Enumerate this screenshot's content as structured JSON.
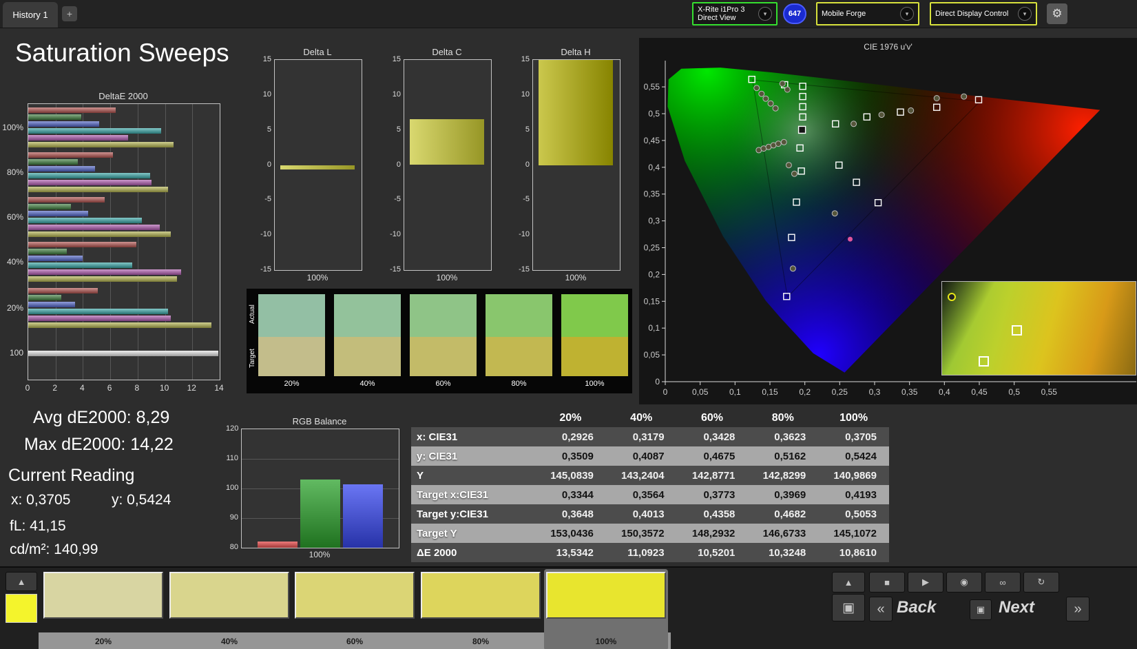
{
  "colors": {
    "meter_green": "#35e02f",
    "control_yellow": "#d8e23c",
    "badge_blue": "#1a2bd0"
  },
  "icons": {
    "chevron_down": "▾",
    "gear": "⚙",
    "add": "+",
    "chevron_up": "▲",
    "stop": "■",
    "play": "▶",
    "record": "◉",
    "continuous": "∞",
    "refresh": "↻",
    "back_chevrons": "«",
    "forward_chevrons": "»",
    "frame": "▣"
  },
  "window": {
    "tabs": [
      {
        "label": "History 1"
      }
    ],
    "meter": {
      "line1": "X-Rite i1Pro 3",
      "line2": "Direct View"
    },
    "meter_badge": "647",
    "source_label": "Mobile Forge",
    "display_control_label": "Direct Display Control"
  },
  "page": {
    "title": "Saturation Sweeps"
  },
  "readouts": {
    "avg": "Avg dE2000: 8,29",
    "max": "Max dE2000: 14,22",
    "current_heading": "Current Reading",
    "x": "x: 0,3705",
    "y": "y: 0,5424",
    "fl": "fL: 41,15",
    "cdm2": "cd/m²: 140,99"
  },
  "table": {
    "columns": [
      "20%",
      "40%",
      "60%",
      "80%",
      "100%"
    ],
    "rows": [
      {
        "label": "x: CIE31",
        "values": [
          "0,2926",
          "0,3179",
          "0,3428",
          "0,3623",
          "0,3705"
        ]
      },
      {
        "label": "y: CIE31",
        "values": [
          "0,3509",
          "0,4087",
          "0,4675",
          "0,5162",
          "0,5424"
        ]
      },
      {
        "label": "Y",
        "values": [
          "145,0839",
          "143,2404",
          "142,8771",
          "142,8299",
          "140,9869"
        ]
      },
      {
        "label": "Target x:CIE31",
        "values": [
          "0,3344",
          "0,3564",
          "0,3773",
          "0,3969",
          "0,4193"
        ]
      },
      {
        "label": "Target y:CIE31",
        "values": [
          "0,3648",
          "0,4013",
          "0,4358",
          "0,4682",
          "0,5053"
        ]
      },
      {
        "label": "Target Y",
        "values": [
          "153,0436",
          "150,3572",
          "148,2932",
          "146,6733",
          "145,1072"
        ]
      },
      {
        "label": "ΔE 2000",
        "values": [
          "13,5342",
          "11,0923",
          "10,5201",
          "10,3248",
          "10,8610"
        ]
      }
    ]
  },
  "swatch_strip": {
    "row_labels": [
      "Actual",
      "Target"
    ],
    "columns": [
      {
        "label": "20%",
        "actual": "#93bfa4",
        "target": "#c3bd8b"
      },
      {
        "label": "40%",
        "actual": "#93c29b",
        "target": "#c3bd7b"
      },
      {
        "label": "60%",
        "actual": "#8fc487",
        "target": "#c3bb68"
      },
      {
        "label": "80%",
        "actual": "#89c66d",
        "target": "#c2b851"
      },
      {
        "label": "100%",
        "actual": "#80c94b",
        "target": "#bfb231"
      }
    ]
  },
  "bottom": {
    "levels": [
      {
        "label": "20%",
        "color": "#d8d5a2",
        "selected": false
      },
      {
        "label": "40%",
        "color": "#d9d58d",
        "selected": false
      },
      {
        "label": "60%",
        "color": "#dbd575",
        "selected": false
      },
      {
        "label": "80%",
        "color": "#ddd55c",
        "selected": false
      },
      {
        "label": "100%",
        "color": "#e8e52e",
        "selected": true
      }
    ],
    "current_color": "#f4f42c",
    "back_label": "Back",
    "next_label": "Next"
  },
  "chart_data": [
    {
      "id": "deltae2000",
      "type": "bar",
      "orientation": "horizontal",
      "title": "DeltaE 2000",
      "xlim": [
        0,
        14
      ],
      "x_ticks": [
        0,
        2,
        4,
        6,
        8,
        10,
        12,
        14
      ],
      "groups": [
        {
          "label": "100%",
          "values": [
            6.4,
            3.9,
            5.2,
            9.7,
            7.3,
            10.6
          ]
        },
        {
          "label": "80%",
          "values": [
            6.2,
            3.6,
            4.9,
            8.9,
            9.0,
            10.2
          ]
        },
        {
          "label": "60%",
          "values": [
            5.6,
            3.1,
            4.4,
            8.3,
            9.6,
            10.4
          ]
        },
        {
          "label": "40%",
          "values": [
            7.9,
            2.8,
            4.0,
            7.6,
            11.2,
            10.9
          ]
        },
        {
          "label": "20%",
          "values": [
            5.1,
            2.4,
            3.4,
            10.2,
            10.4,
            13.4
          ]
        },
        {
          "label": "100",
          "values": [
            13.9
          ]
        }
      ],
      "bar_colors": [
        "#b2524e",
        "#3f7f3f",
        "#5064c8",
        "#38a8a8",
        "#b05ab0",
        "#b4b44e"
      ],
      "white_color": "#e6e6e6"
    },
    {
      "id": "deltaL",
      "type": "bar",
      "title": "Delta L",
      "ylim": [
        -15,
        15
      ],
      "y_ticks": [
        15,
        10,
        5,
        0,
        -5,
        -10,
        -15
      ],
      "x_label": "100%",
      "value": -0.6,
      "color": "#c9c832"
    },
    {
      "id": "deltaC",
      "type": "bar",
      "title": "Delta C",
      "ylim": [
        -15,
        15
      ],
      "y_ticks": [
        15,
        10,
        5,
        0,
        -5,
        -10,
        -15
      ],
      "x_label": "100%",
      "value": 6.5,
      "color": "#c9c832"
    },
    {
      "id": "deltaH",
      "type": "bar",
      "title": "Delta H",
      "ylim": [
        -15,
        15
      ],
      "y_ticks": [
        15,
        10,
        5,
        0,
        -5,
        -10,
        -15
      ],
      "x_label": "100%",
      "value": 15,
      "color": "#b4b000"
    },
    {
      "id": "rgb_balance",
      "type": "bar",
      "title": "RGB Balance",
      "ylim": [
        80,
        120
      ],
      "y_ticks": [
        120,
        110,
        100,
        90,
        80
      ],
      "x_label": "100%",
      "series": [
        {
          "name": "Red",
          "value": 82.2,
          "color": "#e85050"
        },
        {
          "name": "Green",
          "value": 103.0,
          "color": "#2da32d"
        },
        {
          "name": "Blue",
          "value": 101.3,
          "color": "#3848f0"
        }
      ]
    },
    {
      "id": "cie1976",
      "type": "scatter",
      "title": "CIE 1976 u'v'",
      "xlim": [
        0,
        0.676
      ],
      "ylim": [
        0,
        0.599
      ],
      "x_ticks": [
        "0",
        "0,05",
        "0,1",
        "0,15",
        "0,2",
        "0,25",
        "0,3",
        "0,35",
        "0,4",
        "0,45",
        "0,5",
        "0,55"
      ],
      "y_ticks": [
        "0",
        "0,05",
        "0,1",
        "0,15",
        "0,2",
        "0,25",
        "0,3",
        "0,35",
        "0,4",
        "0,45",
        "0,5",
        "0,55"
      ],
      "gamut_triangle": [
        [
          0.451,
          0.523
        ],
        [
          0.125,
          0.563
        ],
        [
          0.175,
          0.158
        ]
      ],
      "targets": [
        [
          0.124,
          0.564
        ],
        [
          0.171,
          0.554
        ],
        [
          0.197,
          0.551
        ],
        [
          0.197,
          0.532
        ],
        [
          0.197,
          0.513
        ],
        [
          0.197,
          0.494
        ],
        [
          0.244,
          0.481
        ],
        [
          0.289,
          0.494
        ],
        [
          0.337,
          0.503
        ],
        [
          0.389,
          0.512
        ],
        [
          0.449,
          0.526
        ],
        [
          0.193,
          0.436
        ],
        [
          0.195,
          0.393
        ],
        [
          0.249,
          0.404
        ],
        [
          0.274,
          0.372
        ],
        [
          0.188,
          0.335
        ],
        [
          0.305,
          0.334
        ],
        [
          0.181,
          0.269
        ],
        [
          0.174,
          0.159
        ]
      ],
      "current_target": [
        0.196,
        0.47
      ],
      "measurements": [
        [
          0.131,
          0.548
        ],
        [
          0.138,
          0.537
        ],
        [
          0.144,
          0.528
        ],
        [
          0.151,
          0.519
        ],
        [
          0.158,
          0.51
        ],
        [
          0.168,
          0.556
        ],
        [
          0.175,
          0.545
        ],
        [
          0.134,
          0.432
        ],
        [
          0.141,
          0.435
        ],
        [
          0.148,
          0.438
        ],
        [
          0.155,
          0.441
        ],
        [
          0.162,
          0.444
        ],
        [
          0.17,
          0.447
        ],
        [
          0.177,
          0.404
        ],
        [
          0.185,
          0.388
        ],
        [
          0.243,
          0.314
        ],
        [
          0.183,
          0.211
        ],
        [
          0.27,
          0.481
        ],
        [
          0.31,
          0.498
        ],
        [
          0.352,
          0.506
        ],
        [
          0.389,
          0.529
        ],
        [
          0.428,
          0.532
        ]
      ],
      "current_measurement": [
        0.265,
        0.266
      ],
      "inset": {
        "squares": [
          [
            0.36,
            0.47
          ],
          [
            0.19,
            0.8
          ]
        ],
        "dot": [
          0.03,
          0.12
        ]
      }
    }
  ]
}
